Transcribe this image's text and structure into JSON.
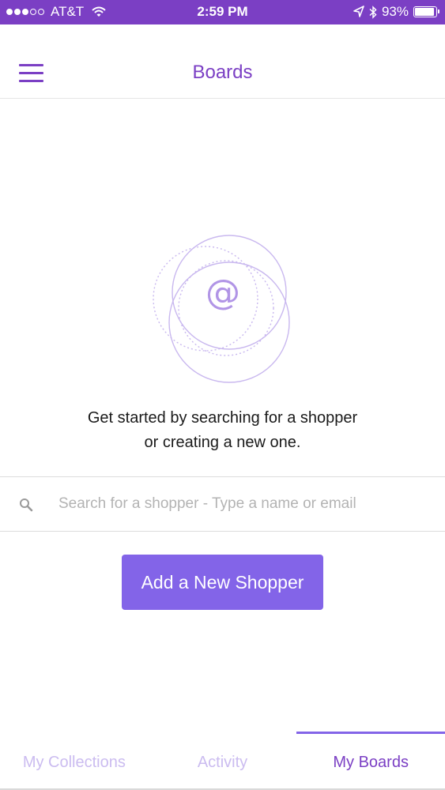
{
  "status_bar": {
    "carrier": "AT&T",
    "time": "2:59 PM",
    "battery": "93%",
    "signal_filled": 3,
    "signal_total": 5
  },
  "nav": {
    "title": "Boards",
    "menu_icon": "hamburger-menu-icon"
  },
  "empty_state": {
    "illustration_icon": "at-sign-icon",
    "symbol": "@",
    "line1": "Get started by searching for a shopper",
    "line2": "or creating a new one."
  },
  "search": {
    "icon": "search-icon",
    "placeholder": "Search for a shopper - Type a name or email",
    "value": ""
  },
  "add_button": {
    "label": "Add a New Shopper"
  },
  "tabs": [
    {
      "label": "My Collections",
      "active": false
    },
    {
      "label": "Activity",
      "active": false
    },
    {
      "label": "My Boards",
      "active": true
    }
  ],
  "colors": {
    "brand": "#7b3fc4",
    "button": "#8364e8",
    "tab_inactive": "#cbbcf0"
  }
}
